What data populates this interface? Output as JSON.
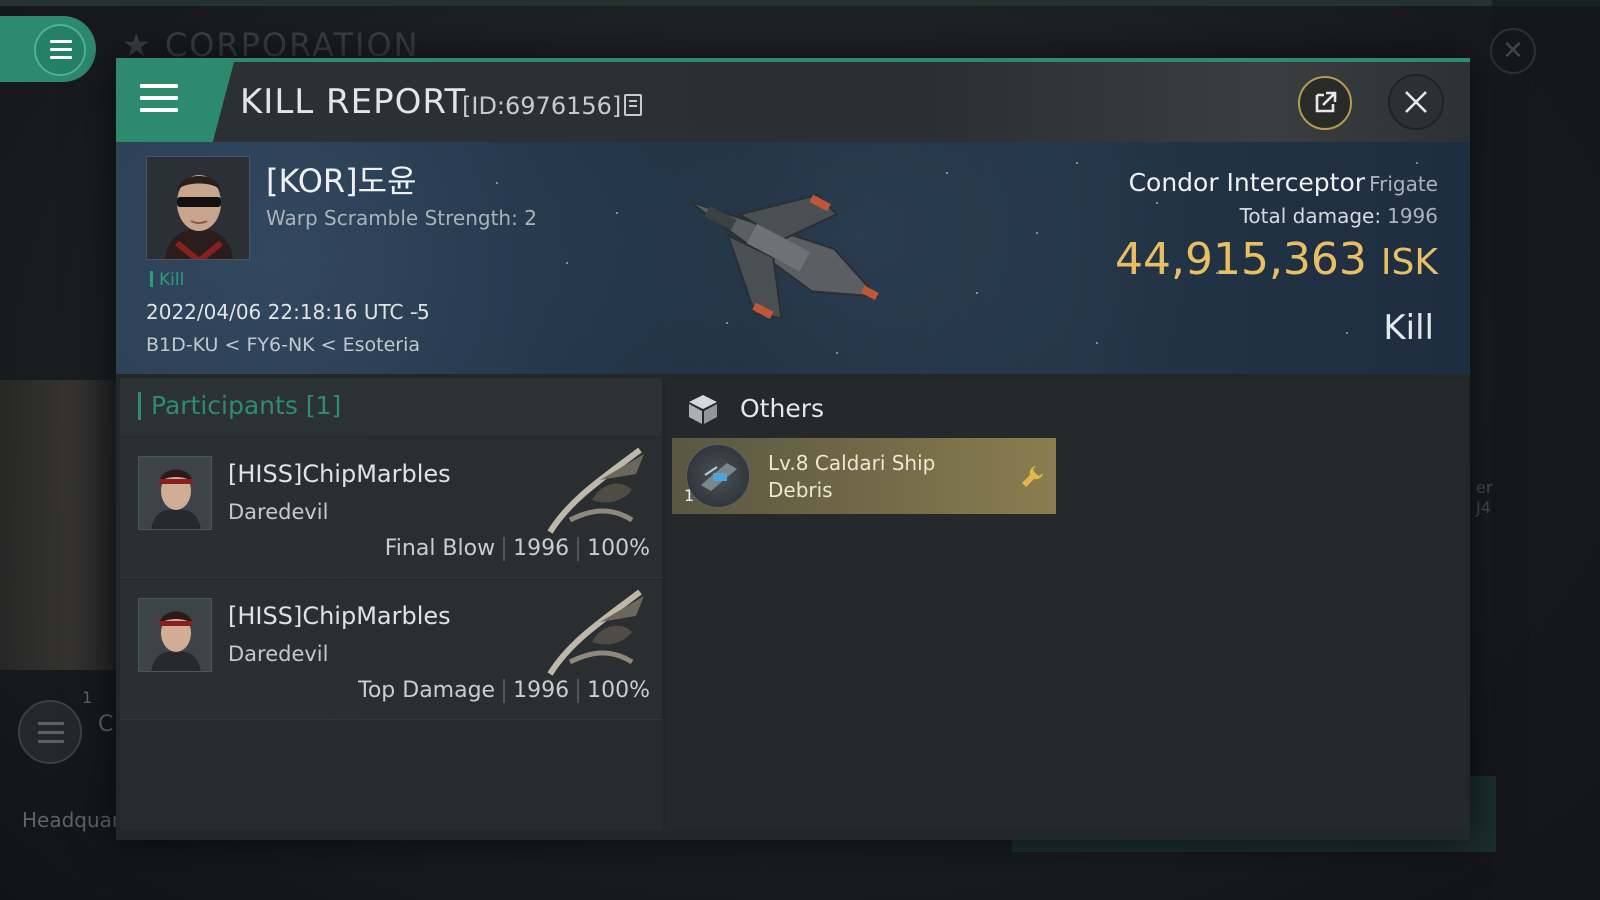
{
  "background": {
    "title": "CORPORATION",
    "bottom_label": "Headquar",
    "left_letter": "C",
    "left_number": "1",
    "right_text_1": "er",
    "right_text_2": "J4"
  },
  "modal": {
    "title": "KILL REPORT",
    "id_text": "[ID:6976156]"
  },
  "victim": {
    "name": "[KOR]도윤",
    "scramble": "Warp Scramble Strength: 2",
    "tag": "Kill",
    "timestamp": "2022/04/06 22:18:16 UTC -5",
    "location": "B1D-KU < FY6-NK < Esoteria"
  },
  "ship": {
    "name": "Condor Interceptor",
    "class": "Frigate",
    "total_damage_label": "Total damage:",
    "total_damage": "1996",
    "value": "44,915,363",
    "currency": "ISK",
    "result": "Kill"
  },
  "participants": {
    "title": "Participants [1]",
    "rows": [
      {
        "name": "[HISS]ChipMarbles",
        "ship": "Daredevil",
        "role": "Final Blow",
        "damage": "1996",
        "percent": "100%"
      },
      {
        "name": "[HISS]ChipMarbles",
        "ship": "Daredevil",
        "role": "Top Damage",
        "damage": "1996",
        "percent": "100%"
      }
    ]
  },
  "others": {
    "title": "Others",
    "items": [
      {
        "qty": "1",
        "name": "Lv.8 Caldari Ship Debris"
      }
    ]
  },
  "colors": {
    "accent_green": "#2e8a6c",
    "isk_gold": "#e8c063",
    "debris_gold": "#8a7d50"
  }
}
